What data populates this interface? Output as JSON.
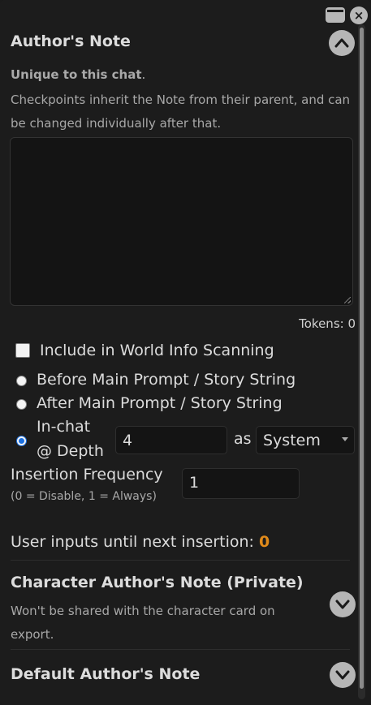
{
  "window": {
    "minimize_icon": "window-minimize-icon",
    "close_label": "×"
  },
  "authors_note": {
    "title": "Author's Note",
    "unique_bold": "Unique to this chat",
    "unique_rest": ".",
    "description": "Checkpoints inherit the Note from their parent, and can be changed individually after that.",
    "note_value": "",
    "tokens_label": "Tokens: 0",
    "include_wi_label": "Include in World Info Scanning",
    "include_wi_checked": false,
    "positions": [
      {
        "label": "Before Main Prompt / Story String",
        "checked": false
      },
      {
        "label": "After Main Prompt / Story String",
        "checked": false
      },
      {
        "label_line1": "In-chat",
        "label_line2": "@ Depth",
        "checked": true
      }
    ],
    "depth_value": "4",
    "as_label": "as",
    "role_selected": "System",
    "insertion_frequency_label": "Insertion Frequency",
    "insertion_frequency_hint": "(0 = Disable, 1 = Always)",
    "insertion_frequency_value": "1",
    "user_inputs_label": "User inputs until next insertion:",
    "user_inputs_value": "0"
  },
  "character_note": {
    "title": "Character Author's Note (Private)",
    "description": "Won't be shared with the character card on export."
  },
  "default_note": {
    "title": "Default Author's Note"
  },
  "colors": {
    "accent_orange": "#e08a1a",
    "radio_blue": "#1a6fe0",
    "panel_bg": "#1c1c1c"
  }
}
